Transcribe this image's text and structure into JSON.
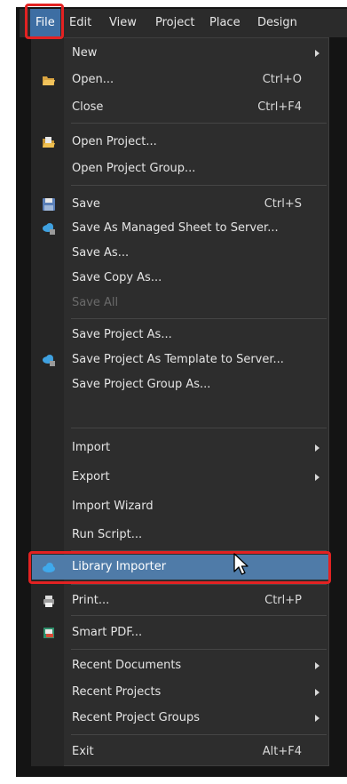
{
  "menubar": {
    "items": [
      "File",
      "Edit",
      "View",
      "Project",
      "Place",
      "Design"
    ]
  },
  "menu": {
    "new": {
      "label": "New"
    },
    "open": {
      "label": "Open...",
      "shortcut": "Ctrl+O",
      "icon": "folder-open-icon"
    },
    "close": {
      "label": "Close",
      "shortcut": "Ctrl+F4"
    },
    "open_project": {
      "label": "Open Project...",
      "icon": "open-project-icon"
    },
    "open_project_group": {
      "label": "Open Project Group..."
    },
    "save": {
      "label": "Save",
      "shortcut": "Ctrl+S",
      "icon": "floppy-disk-icon"
    },
    "save_managed": {
      "label": "Save As Managed Sheet to Server...",
      "icon": "cloud-upload-icon"
    },
    "save_as": {
      "label": "Save As..."
    },
    "save_copy_as": {
      "label": "Save Copy As..."
    },
    "save_all": {
      "label": "Save All"
    },
    "save_project_as": {
      "label": "Save Project As..."
    },
    "save_project_template": {
      "label": "Save Project As Template to Server...",
      "icon": "cloud-upload-icon"
    },
    "save_project_group_as": {
      "label": "Save Project Group As..."
    },
    "import": {
      "label": "Import"
    },
    "export": {
      "label": "Export"
    },
    "import_wizard": {
      "label": "Import Wizard"
    },
    "run_script": {
      "label": "Run Script..."
    },
    "library_importer": {
      "label": "Library Importer",
      "icon": "cloud-icon"
    },
    "print": {
      "label": "Print...",
      "shortcut": "Ctrl+P",
      "icon": "printer-icon"
    },
    "smart_pdf": {
      "label": "Smart PDF...",
      "icon": "pdf-icon"
    },
    "recent_documents": {
      "label": "Recent Documents"
    },
    "recent_projects": {
      "label": "Recent Projects"
    },
    "recent_project_groups": {
      "label": "Recent Project Groups"
    },
    "exit": {
      "label": "Exit",
      "shortcut": "Alt+F4"
    }
  },
  "colors": {
    "highlight": "#4f7ba8",
    "annotation_red": "#e32222",
    "menu_background": "#2d2d2d"
  }
}
